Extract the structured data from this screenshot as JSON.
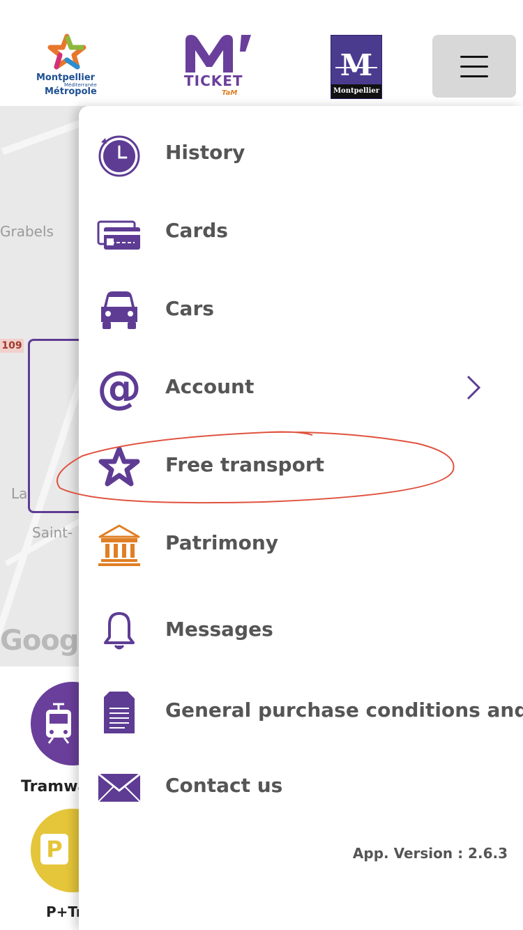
{
  "header": {
    "logo_metropole": {
      "line1": "Montpellier",
      "line2": "Méditerranée",
      "line3": "Métropole"
    },
    "logo_ticket": {
      "word": "TICKET",
      "brand": "TaM"
    },
    "logo_montpellier": {
      "letter": "M",
      "name": "Montpellier"
    },
    "menu_icon": "hamburger-icon"
  },
  "map": {
    "places": [
      "Grabels",
      "La",
      "Saint-"
    ],
    "road_number": "109",
    "google": "Google"
  },
  "bottom_panel": {
    "tram_label": "Tramway",
    "park_label": "P+Tr",
    "park_badge": "P"
  },
  "menu": {
    "items": [
      {
        "label": "History",
        "icon": "history-clock-icon"
      },
      {
        "label": "Cards",
        "icon": "cards-icon"
      },
      {
        "label": "Cars",
        "icon": "car-icon"
      },
      {
        "label": "Account",
        "icon": "at-sign-icon",
        "has_submenu": true
      },
      {
        "label": "Free transport",
        "icon": "star-icon",
        "highlighted": true
      },
      {
        "label": "Patrimony",
        "icon": "museum-icon"
      },
      {
        "label": "Messages",
        "icon": "bell-icon"
      },
      {
        "label": "General purchase conditions and",
        "icon": "document-icon"
      },
      {
        "label": "Contact us",
        "icon": "envelope-icon"
      }
    ],
    "version": "App. Version : 2.6.3"
  },
  "colors": {
    "brand_purple": "#5e3c94",
    "patrimony_orange": "#e07f25",
    "highlight_red": "#e0523f",
    "menu_text": "#555555"
  }
}
